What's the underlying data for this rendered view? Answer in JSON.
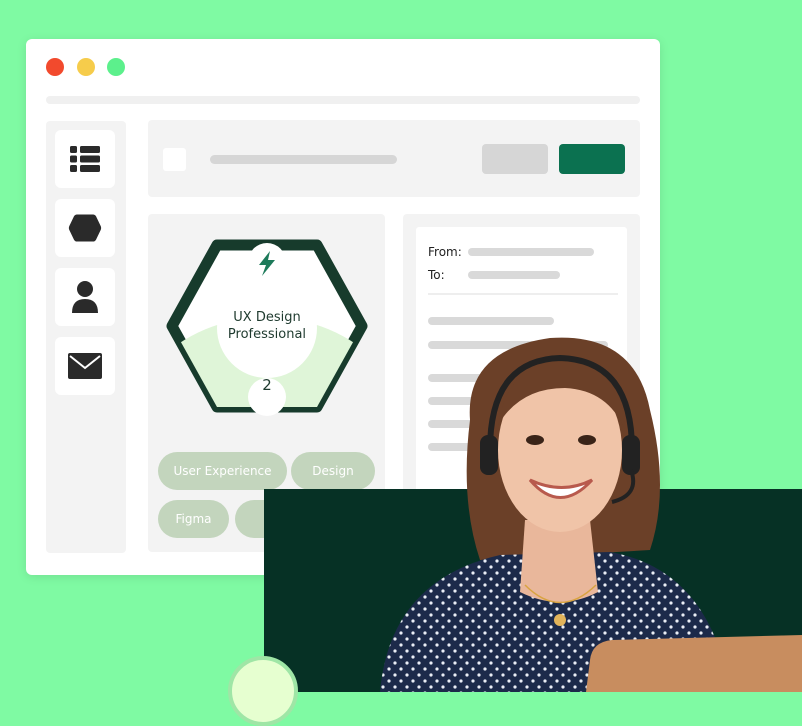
{
  "badge": {
    "title": "UX Design Professional",
    "level": "2",
    "icon": "lightning-bolt-icon"
  },
  "tags": [
    "User Experience",
    "Design",
    "Figma",
    ""
  ],
  "email": {
    "from_label": "From:",
    "to_label": "To:"
  },
  "sidebar": {
    "icons": [
      "list-icon",
      "hexagon-icon",
      "user-icon",
      "mail-icon"
    ]
  },
  "colors": {
    "background": "#7ffaa3",
    "accent": "#0b7150",
    "dark": "#063125",
    "badge_border": "#173b2c",
    "tag": "#c3d5bd"
  }
}
